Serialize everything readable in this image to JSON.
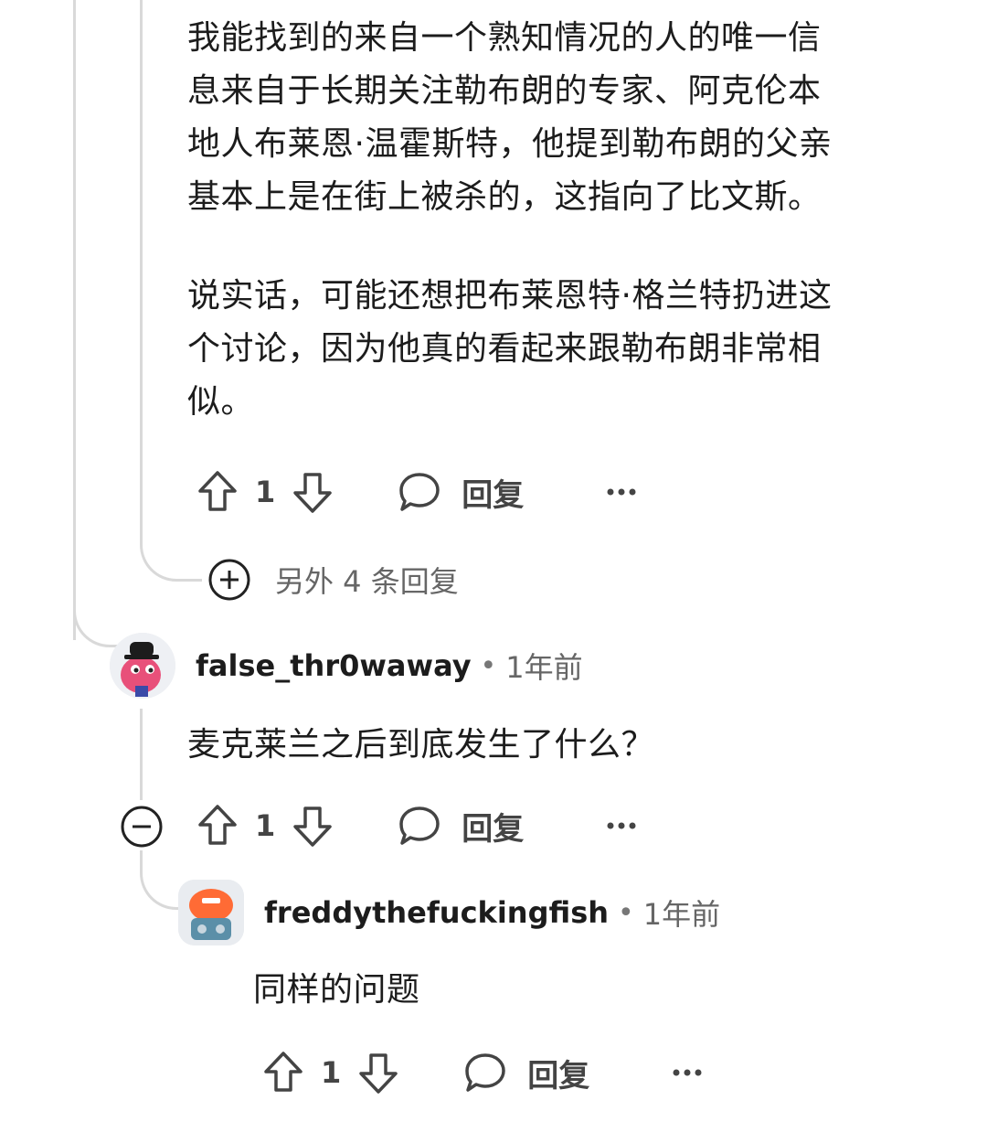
{
  "top_comment": {
    "paragraph_1_lines": [
      "我能找到的来自一个熟知情况的人的唯一信",
      "息来自于长期关注勒布朗的专家、阿克伦本",
      "地人布莱恩·温霍斯特，他提到勒布朗的父亲",
      "基本上是在街上被杀的，这指向了比文斯。"
    ],
    "paragraph_2_lines": [
      "说实话，可能还想把布莱恩特·格兰特扔进这",
      "个讨论，因为他真的看起来跟勒布朗非常相",
      "似。"
    ],
    "vote_count": "1",
    "reply_label": "回复"
  },
  "more_replies": {
    "label": "另外 4 条回复"
  },
  "comment_2": {
    "username": "false_thr0waway",
    "separator": "•",
    "time": "1年前",
    "text": "麦克莱兰之后到底发生了什么？",
    "vote_count": "1",
    "reply_label": "回复"
  },
  "comment_3": {
    "username": "freddythefuckingfish",
    "separator": "•",
    "time": "1年前",
    "text": "同样的问题",
    "vote_count": "1",
    "reply_label": "回复"
  },
  "icons": {
    "upvote": "arrow-up-icon",
    "downvote": "arrow-down-icon",
    "reply": "speech-bubble-icon",
    "more": "ellipsis-icon",
    "expand": "plus-circle-icon",
    "collapse": "minus-circle-icon"
  },
  "colors": {
    "text": "#1c1c1c",
    "muted": "#666666",
    "thread_line": "#d9d9d9",
    "avatar_1": "#e8507a",
    "avatar_2": "#ff6b35"
  }
}
